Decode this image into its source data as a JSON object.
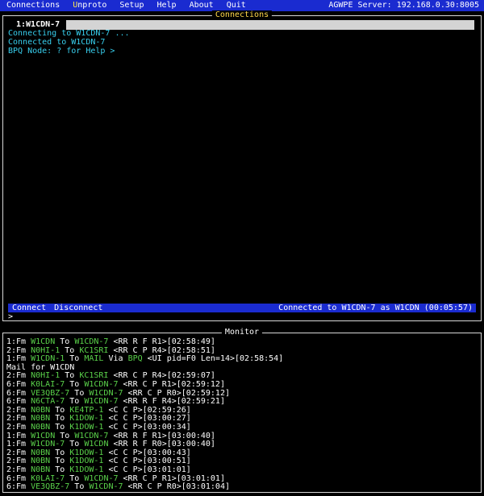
{
  "menu": {
    "items": [
      {
        "hotkey": "",
        "rest": "Connections"
      },
      {
        "hotkey": "U",
        "rest": "nproto"
      },
      {
        "hotkey": "",
        "rest": "Setup"
      },
      {
        "hotkey": "",
        "rest": "Help"
      },
      {
        "hotkey": "",
        "rest": "About"
      },
      {
        "hotkey": "",
        "rest": "Quit"
      }
    ],
    "server": "AGWPE Server: 192.168.0.30:8005"
  },
  "connections": {
    "title": "Connections",
    "tab": "1:W1CDN-7",
    "lines": [
      "Connecting to W1CDN-7 ...",
      "Connected to W1CDN-7",
      "BPQ Node: ? for Help >"
    ],
    "connect_label": "Connect",
    "disconnect_label": "Disconnect",
    "status": "Connected to W1CDN-7 as W1CDN (00:05:57)",
    "prompt": ">"
  },
  "monitor": {
    "title": "Monitor",
    "lines": [
      [
        [
          "1:Fm ",
          0
        ],
        [
          "W1CDN",
          1
        ],
        [
          " To ",
          0
        ],
        [
          "W1CDN-7",
          1
        ],
        [
          " <RR R F R1>[02:58:49]",
          0
        ]
      ],
      [
        [
          "2:Fm ",
          0
        ],
        [
          "N0HI-1",
          1
        ],
        [
          " To ",
          0
        ],
        [
          "KC1SRI",
          1
        ],
        [
          " <RR C P R4>[02:58:51]",
          0
        ]
      ],
      [
        [
          "1:Fm ",
          0
        ],
        [
          "W1CDN-1",
          1
        ],
        [
          " To ",
          0
        ],
        [
          "MAIL",
          1
        ],
        [
          " Via ",
          0
        ],
        [
          "BPQ",
          1
        ],
        [
          " <UI pid=F0 Len=14>[02:58:54]",
          0
        ]
      ],
      [
        [
          "Mail for W1CDN",
          0
        ]
      ],
      [
        [
          "2:Fm ",
          0
        ],
        [
          "N0HI-1",
          1
        ],
        [
          " To ",
          0
        ],
        [
          "KC1SRI",
          1
        ],
        [
          " <RR C P R4>[02:59:07]",
          0
        ]
      ],
      [
        [
          "6:Fm ",
          0
        ],
        [
          "K0LAI-7",
          1
        ],
        [
          " To ",
          0
        ],
        [
          "W1CDN-7",
          1
        ],
        [
          " <RR C P R1>[02:59:12]",
          0
        ]
      ],
      [
        [
          "6:Fm ",
          0
        ],
        [
          "VE3QBZ-7",
          1
        ],
        [
          " To ",
          0
        ],
        [
          "W1CDN-7",
          1
        ],
        [
          " <RR C P R0>[02:59:12]",
          0
        ]
      ],
      [
        [
          "6:Fm ",
          0
        ],
        [
          "N6CTA-7",
          1
        ],
        [
          " To ",
          0
        ],
        [
          "W1CDN-7",
          1
        ],
        [
          " <RR R F R4>[02:59:21]",
          0
        ]
      ],
      [
        [
          "2:Fm ",
          0
        ],
        [
          "N0BN",
          1
        ],
        [
          " To ",
          0
        ],
        [
          "KE4TP-1",
          1
        ],
        [
          " <C C P>[02:59:26]",
          0
        ]
      ],
      [
        [
          "2:Fm ",
          0
        ],
        [
          "N0BN",
          1
        ],
        [
          " To ",
          0
        ],
        [
          "K1DOW-1",
          1
        ],
        [
          " <C C P>[03:00:27]",
          0
        ]
      ],
      [
        [
          "2:Fm ",
          0
        ],
        [
          "N0BN",
          1
        ],
        [
          " To ",
          0
        ],
        [
          "K1DOW-1",
          1
        ],
        [
          " <C C P>[03:00:34]",
          0
        ]
      ],
      [
        [
          "1:Fm ",
          0
        ],
        [
          "W1CDN",
          1
        ],
        [
          " To ",
          0
        ],
        [
          "W1CDN-7",
          1
        ],
        [
          " <RR R F R1>[03:00:40]",
          0
        ]
      ],
      [
        [
          "1:Fm ",
          0
        ],
        [
          "W1CDN-7",
          1
        ],
        [
          " To ",
          0
        ],
        [
          "W1CDN",
          1
        ],
        [
          " <RR R F R0>[03:00:40]",
          0
        ]
      ],
      [
        [
          "2:Fm ",
          0
        ],
        [
          "N0BN",
          1
        ],
        [
          " To ",
          0
        ],
        [
          "K1DOW-1",
          1
        ],
        [
          " <C C P>[03:00:43]",
          0
        ]
      ],
      [
        [
          "2:Fm ",
          0
        ],
        [
          "N0BN",
          1
        ],
        [
          " To ",
          0
        ],
        [
          "K1DOW-1",
          1
        ],
        [
          " <C C P>[03:00:51]",
          0
        ]
      ],
      [
        [
          "2:Fm ",
          0
        ],
        [
          "N0BN",
          1
        ],
        [
          " To ",
          0
        ],
        [
          "K1DOW-1",
          1
        ],
        [
          " <C C P>[03:01:01]",
          0
        ]
      ],
      [
        [
          "6:Fm ",
          0
        ],
        [
          "K0LAI-7",
          1
        ],
        [
          " To ",
          0
        ],
        [
          "W1CDN-7",
          1
        ],
        [
          " <RR C P R1>[03:01:01]",
          0
        ]
      ],
      [
        [
          "6:Fm ",
          0
        ],
        [
          "VE3QBZ-7",
          1
        ],
        [
          " To ",
          0
        ],
        [
          "W1CDN-7",
          1
        ],
        [
          " <RR C P R0>[03:01:04]",
          0
        ]
      ]
    ]
  }
}
